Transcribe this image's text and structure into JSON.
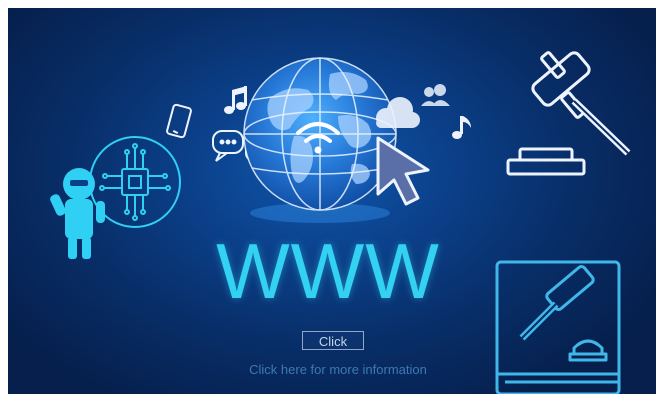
{
  "headline": "WWW",
  "button": {
    "label": "Click"
  },
  "caption": "Click here for more information",
  "colors": {
    "background_center": "#0f57ac",
    "background_edge": "#061f4c",
    "accent_cyan": "#33d1f2",
    "globe_blue": "#2a86e0",
    "icon_white": "#eef4ff"
  },
  "icons": [
    "robot-icon",
    "chip-icon",
    "smartphone-icon",
    "music-note-icon",
    "chat-bubbles-icon",
    "globe-icon",
    "wifi-icon",
    "cloud-icon",
    "users-icon",
    "cursor-arrow-icon",
    "gavel-icon",
    "law-book-icon"
  ]
}
